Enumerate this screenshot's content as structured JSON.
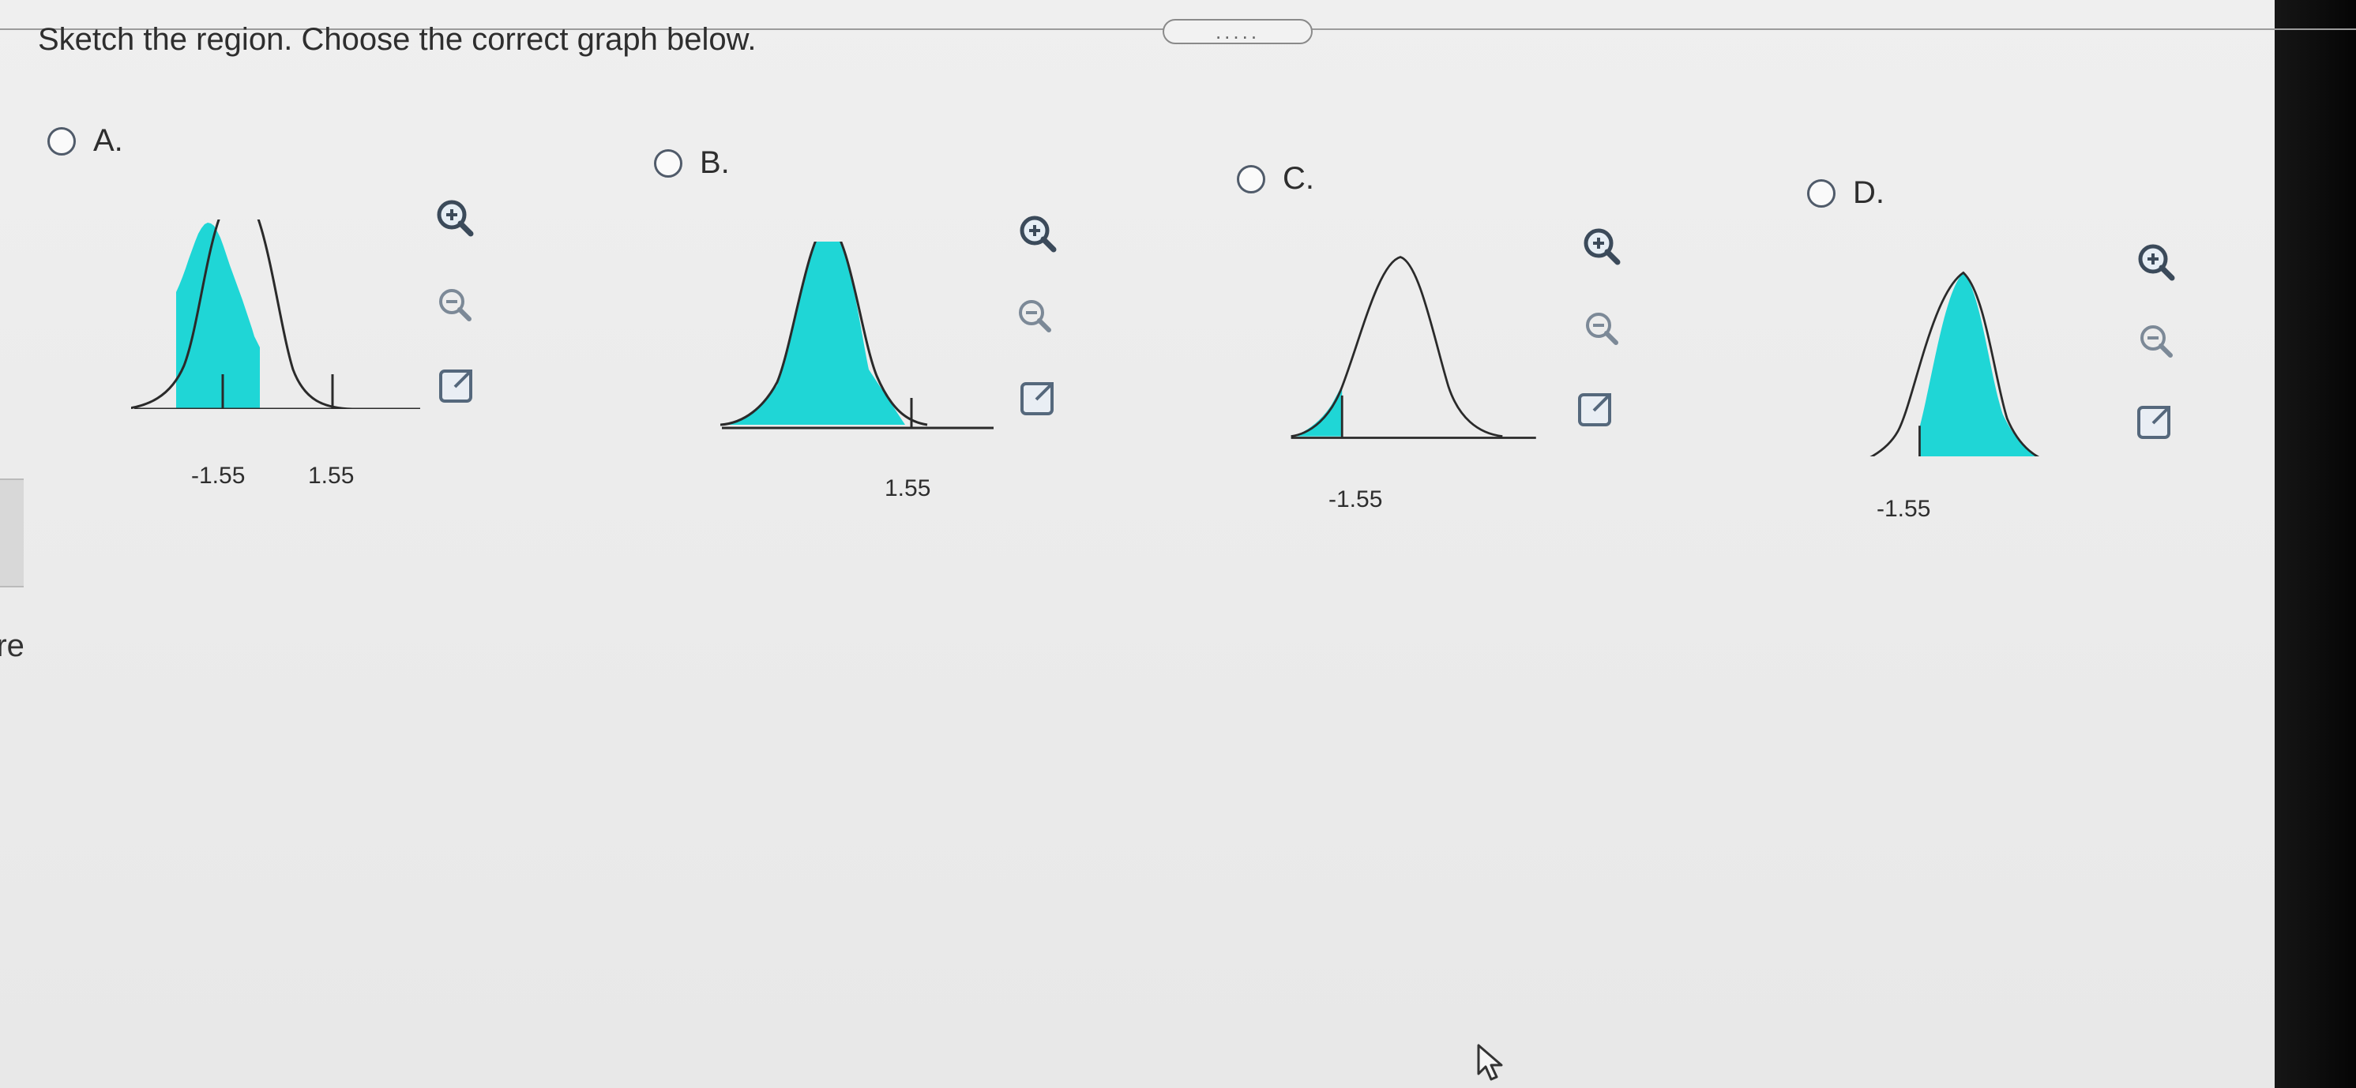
{
  "question": "Sketch the region. Choose the correct graph below.",
  "drag_handle": ".....",
  "left_partial_text": "rre",
  "colors": {
    "shade": "#1fd6d6",
    "curve": "#2a2a2a",
    "radio": "#505b6a"
  },
  "options": [
    {
      "letter": "A.",
      "labels": [
        "-1.55",
        "1.55"
      ],
      "shaded": "between -1.55 and 1.55"
    },
    {
      "letter": "B.",
      "labels": [
        "1.55"
      ],
      "shaded": "left of 1.55"
    },
    {
      "letter": "C.",
      "labels": [
        "-1.55"
      ],
      "shaded": "left of -1.55"
    },
    {
      "letter": "D.",
      "labels": [
        "-1.55"
      ],
      "shaded": "right of -1.55"
    }
  ],
  "tools": {
    "zoom_in": "zoom-in-icon",
    "zoom_out": "zoom-out-icon",
    "popout": "popout-icon"
  }
}
